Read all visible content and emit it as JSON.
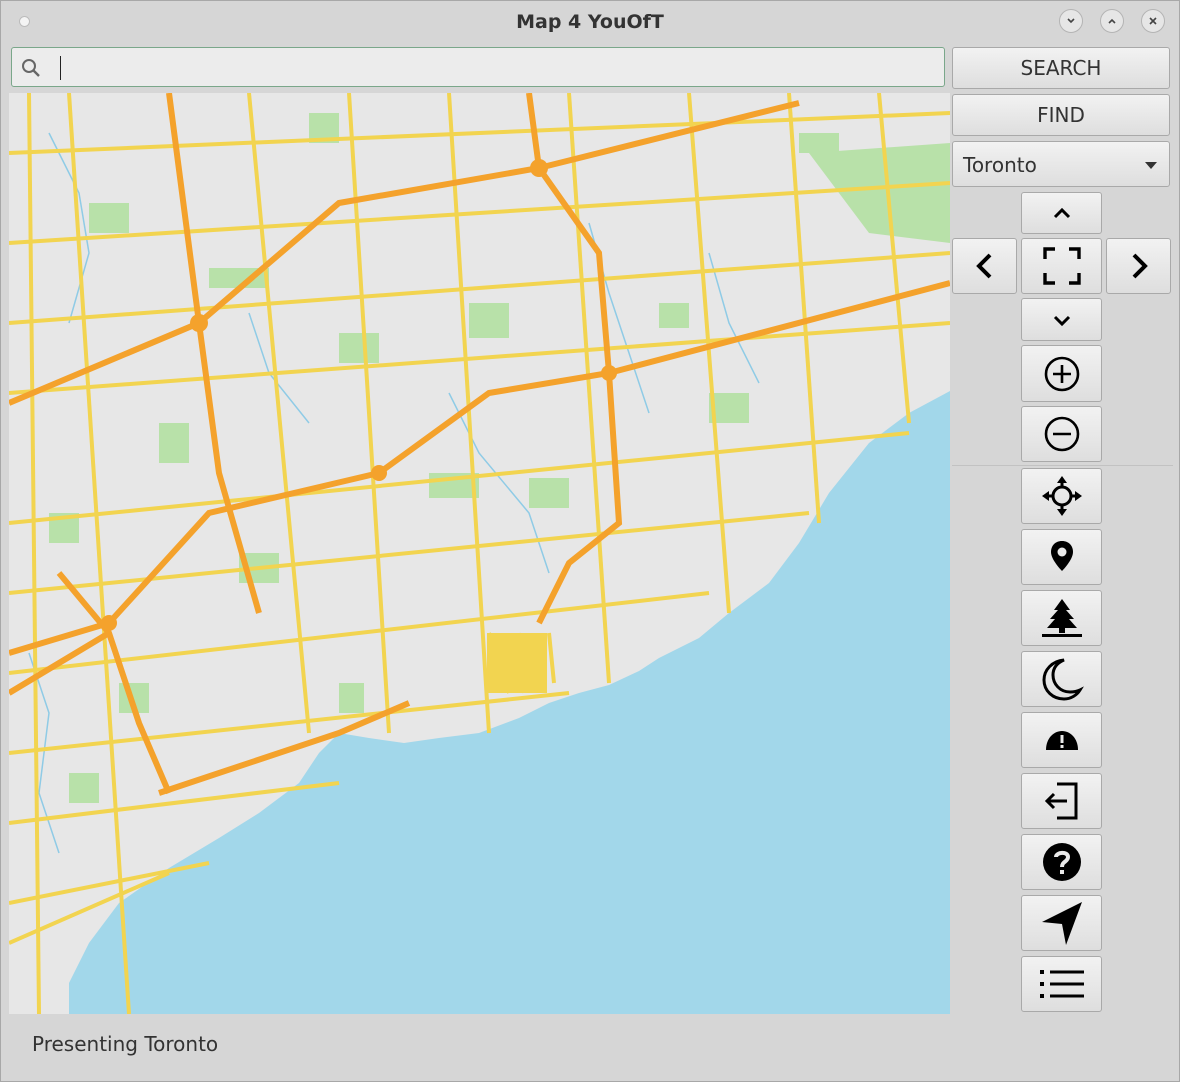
{
  "window": {
    "title": "Map 4 YouOfT",
    "controls": {
      "minimize": "chevron-down-icon",
      "maximize": "chevron-up-icon",
      "close": "close-icon"
    }
  },
  "search": {
    "value": "",
    "placeholder": ""
  },
  "buttons": {
    "search_label": "SEARCH",
    "find_label": "FIND"
  },
  "city_select": {
    "selected": "Toronto"
  },
  "nav_icons": [
    "arrow-up-icon",
    "arrow-left-icon",
    "fullscreen-icon",
    "arrow-right-icon",
    "arrow-down-icon",
    "zoom-in-icon",
    "zoom-out-icon"
  ],
  "tool_icons": [
    "move-icon",
    "map-pin-icon",
    "tree-icon",
    "moon-icon",
    "warning-icon",
    "exit-icon",
    "help-icon",
    "navigate-icon",
    "list-icon"
  ],
  "map": {
    "colors": {
      "land": "#e7e7e7",
      "water": "#a2d7ea",
      "park": "#b8e1a9",
      "road": "#f2d450",
      "highway": "#f4a22c",
      "river": "#8fcbe6"
    }
  },
  "status": {
    "text": "Presenting Toronto"
  }
}
